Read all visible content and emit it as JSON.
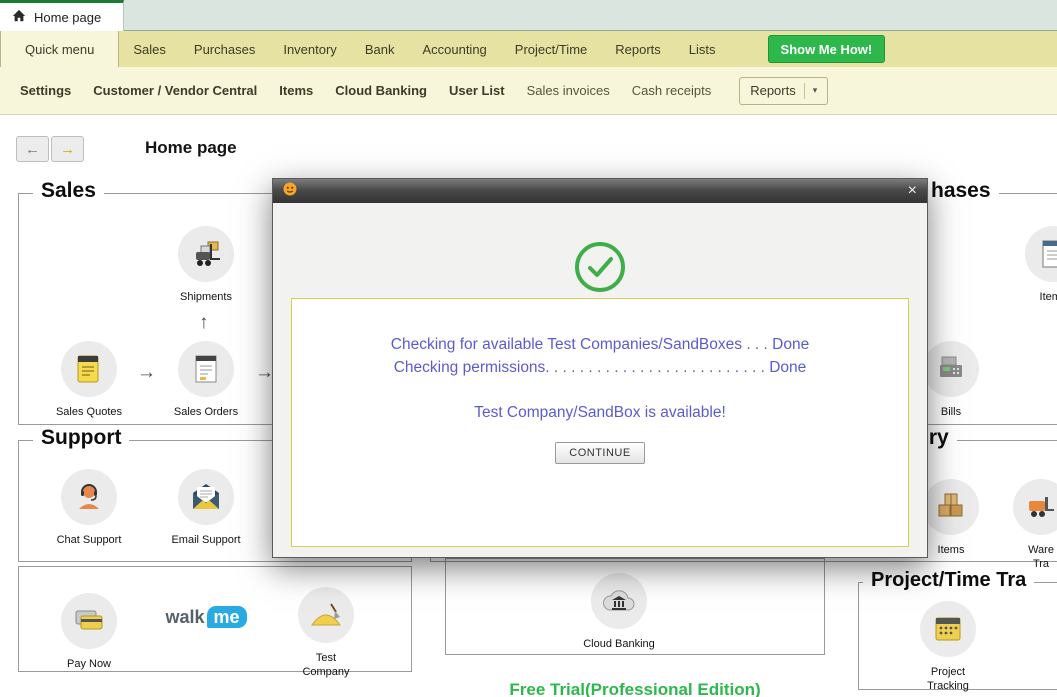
{
  "tab_bar": {
    "home_tab_label": "Home page"
  },
  "menu_bar": {
    "items": [
      "Quick menu",
      "Sales",
      "Purchases",
      "Inventory",
      "Bank",
      "Accounting",
      "Project/Time",
      "Reports",
      "Lists"
    ],
    "show_me_how_label": "Show Me How!"
  },
  "toolbar": {
    "settings": "Settings",
    "customer_vendor_central": "Customer / Vendor Central",
    "items": "Items",
    "cloud_banking": "Cloud Banking",
    "user_list": "User List",
    "sales_invoices": "Sales invoices",
    "cash_receipts": "Cash receipts",
    "reports": "Reports",
    "reports_caret": "▾"
  },
  "nav": {
    "back": "←",
    "forward": "→",
    "page_title": "Home page"
  },
  "sales_section": {
    "title": "Sales",
    "shipments": "Shipments",
    "sales_quotes": "Sales Quotes",
    "sales_orders": "Sales Orders",
    "arrow_up": "↑",
    "arrow_right": "→"
  },
  "support_section": {
    "title": "Support",
    "chat_support": "Chat Support",
    "email_support": "Email Support"
  },
  "payment_row": {
    "pay_now": "Pay Now",
    "walkme_text": "walk",
    "walkme_bubble": "me",
    "test_company_line1": "Test",
    "test_company_line2": "Company"
  },
  "purchases_section": {
    "title_visible": "hases",
    "item_list_label": "Item l",
    "bills": "Bills"
  },
  "inventory_section": {
    "title_visible": "tory",
    "items": "Items",
    "warehouse_line1": "Ware",
    "warehouse_line2": "Tra"
  },
  "project_section": {
    "title_visible": "Project/Time Tra",
    "tracking_line1": "Project",
    "tracking_line2": "Tracking"
  },
  "bank_section": {
    "cloud_banking": "Cloud Banking"
  },
  "footer": {
    "free_trial": "Free Trial(Professional Edition)"
  },
  "dialog": {
    "close": "×",
    "line1": "Checking for available Test Companies/SandBoxes . . . Done",
    "line2": "Checking permissions. . . . . . . . . . . . . . . . . . . . . . . . . . Done",
    "line3": "Test Company/SandBox is available!",
    "continue_label": "CONTINUE"
  },
  "colors": {
    "show_me_how_green": "#2eb84b",
    "dialog_message_blue": "#5b5bd0",
    "check_green": "#3fae49",
    "message_box_border": "#d8ce58",
    "menu_bar_bg": "#e6e2a2",
    "toolbar_bg": "#f7f5da",
    "free_trial_green": "#2eb84b"
  }
}
